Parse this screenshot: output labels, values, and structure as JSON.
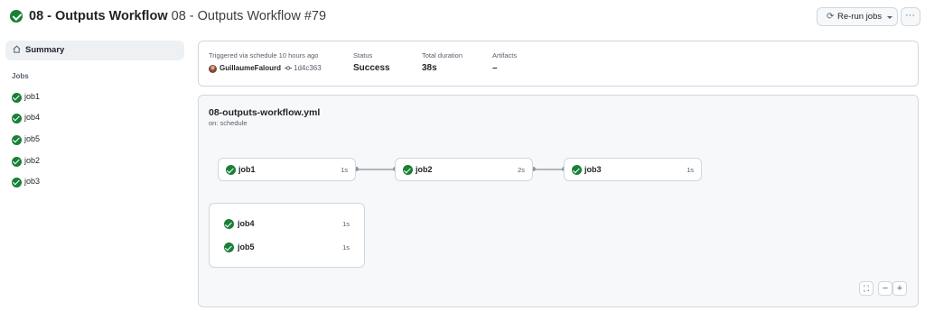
{
  "header": {
    "workflow_name": "08 - Outputs Workflow",
    "run_title": "08 - Outputs Workflow #79",
    "status_icon": "check-circle-fill-icon",
    "rerun_label": "Re-run jobs",
    "more_label": "···"
  },
  "sidebar": {
    "summary_label": "Summary",
    "jobs_heading": "Jobs",
    "jobs": [
      {
        "label": "job1",
        "status": "success"
      },
      {
        "label": "job4",
        "status": "success"
      },
      {
        "label": "job5",
        "status": "success"
      },
      {
        "label": "job2",
        "status": "success"
      },
      {
        "label": "job3",
        "status": "success"
      }
    ]
  },
  "summary": {
    "trigger_text": "Triggered via schedule 10 hours ago",
    "actor": "GuillaumeFalourd",
    "commit": "1d4c363",
    "status_label": "Status",
    "status_value": "Success",
    "duration_label": "Total duration",
    "duration_value": "38s",
    "artifacts_label": "Artifacts",
    "artifacts_value": "–"
  },
  "graph": {
    "file": "08-outputs-workflow.yml",
    "trigger": "on: schedule",
    "nodes": [
      {
        "label": "job1",
        "duration": "1s"
      },
      {
        "label": "job2",
        "duration": "2s"
      },
      {
        "label": "job3",
        "duration": "1s"
      }
    ],
    "group": [
      {
        "label": "job4",
        "duration": "1s"
      },
      {
        "label": "job5",
        "duration": "1s"
      }
    ],
    "controls": {
      "fullscreen": "⛶",
      "zoom_out": "−",
      "zoom_in": "+"
    }
  },
  "colors": {
    "success": "#1a7f37",
    "border": "#d0d7de",
    "panel": "#f6f8fa"
  }
}
